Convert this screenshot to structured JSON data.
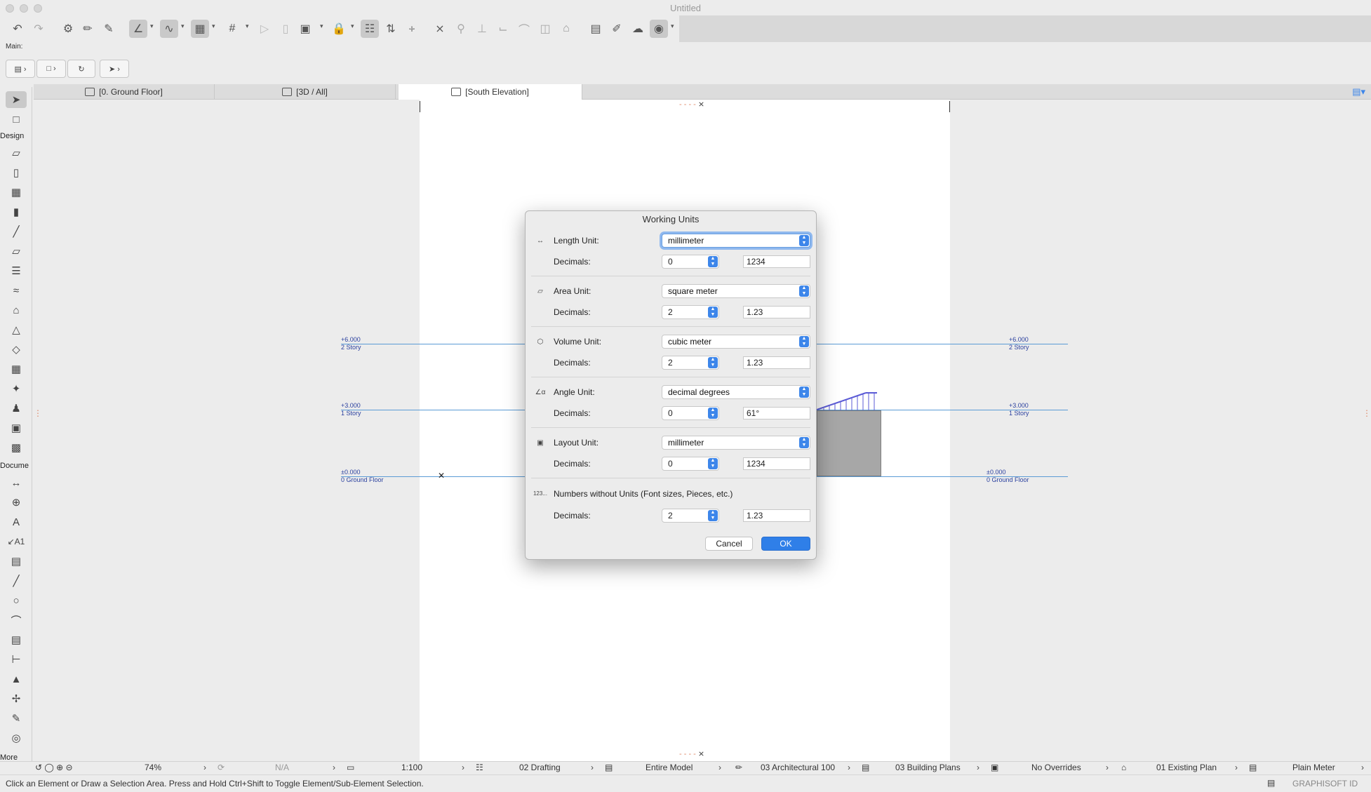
{
  "window": {
    "title": "Untitled"
  },
  "toolbar": {
    "main_label": "Main:"
  },
  "tabs": [
    {
      "label": "[0. Ground Floor]"
    },
    {
      "label": "[3D / All]"
    },
    {
      "label": "[South Elevation]"
    }
  ],
  "toolbox": {
    "design_label": "Design",
    "document_label": "Docume",
    "more_label": "More"
  },
  "levels": [
    {
      "value": "+6.000",
      "name": "2 Story"
    },
    {
      "value": "+3.000",
      "name": "1 Story"
    },
    {
      "value": "±0.000",
      "name": "0 Ground Floor"
    }
  ],
  "dialog": {
    "title": "Working Units",
    "decimals_label": "Decimals:",
    "rows": [
      {
        "icon": "length-unit-icon",
        "label": "Length Unit:",
        "unit": "millimeter",
        "decimals": "0",
        "sample": "1234"
      },
      {
        "icon": "area-unit-icon",
        "label": "Area Unit:",
        "unit": "square meter",
        "decimals": "2",
        "sample": "1.23"
      },
      {
        "icon": "volume-unit-icon",
        "label": "Volume Unit:",
        "unit": "cubic meter",
        "decimals": "2",
        "sample": "1.23"
      },
      {
        "icon": "angle-unit-icon",
        "label": "Angle Unit:",
        "unit": "decimal degrees",
        "decimals": "0",
        "sample": "61°"
      },
      {
        "icon": "layout-unit-icon",
        "label": "Layout Unit:",
        "unit": "millimeter",
        "decimals": "0",
        "sample": "1234"
      }
    ],
    "numbers": {
      "label": "Numbers without Units (Font sizes, Pieces, etc.)",
      "icon_text": "123...",
      "decimals": "2",
      "sample": "1.23"
    },
    "cancel_label": "Cancel",
    "ok_label": "OK"
  },
  "bottombar": {
    "zoom": "74%",
    "rotation": "N/A",
    "scale": "1:100",
    "layer_combo": "02 Drafting",
    "model_view": "Entire Model",
    "pen_set": "03 Architectural 100",
    "mvo": "03 Building Plans",
    "overrides": "No Overrides",
    "renovation": "01 Existing Plan",
    "dimension": "Plain Meter"
  },
  "statusbar": {
    "message": "Click an Element or Draw a Selection Area. Press and Hold Ctrl+Shift to Toggle Element/Sub-Element Selection.",
    "brand": "GRAPHISOFT ID"
  },
  "colors": {
    "accent": "#2f7fe8",
    "level_line": "#5b9bd5",
    "level_text": "#2a3f9e"
  }
}
